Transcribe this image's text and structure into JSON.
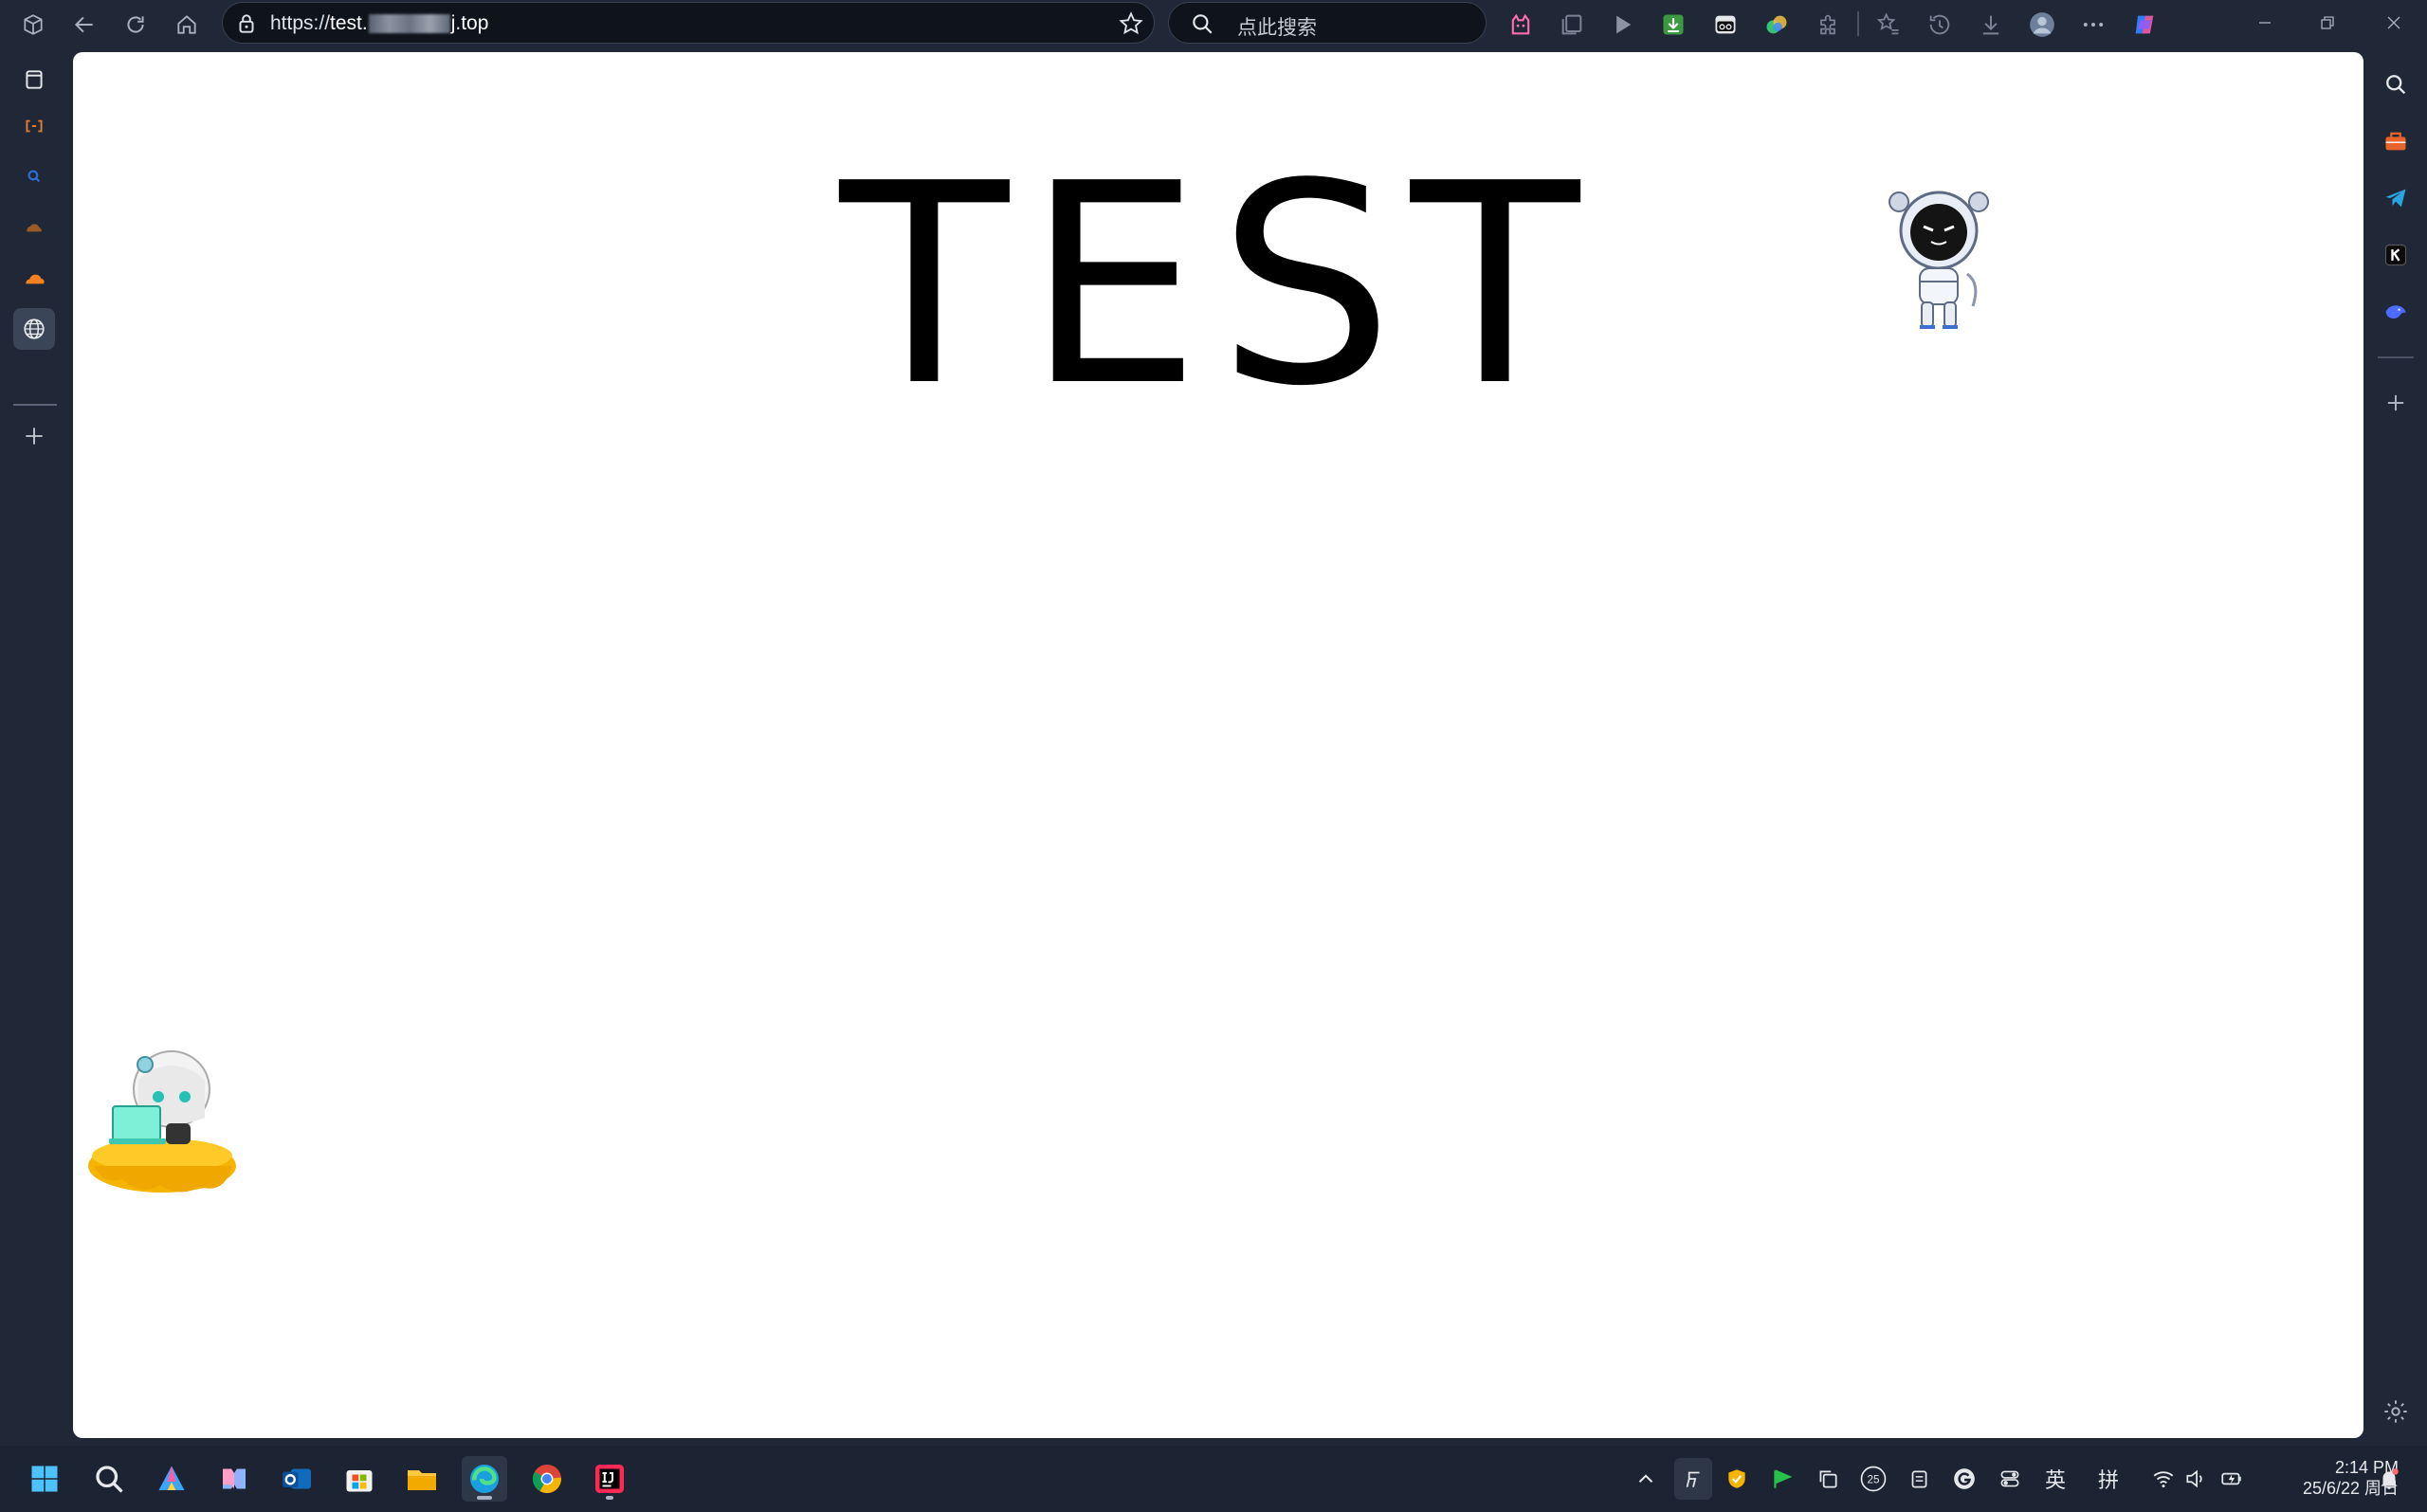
{
  "browser": {
    "address_bar": {
      "url_prefix": "https://",
      "url_host_start": "test.",
      "url_host_end": "j.top"
    },
    "search_box": {
      "placeholder": "点此搜索"
    }
  },
  "page": {
    "heading": "TEST"
  },
  "taskbar": {
    "tray": {
      "ime_lang": "英",
      "ime_mode": "拼",
      "calendar_badge": "25"
    },
    "clock": {
      "time": "2:14 PM",
      "date": "25/6/22 周日"
    }
  },
  "colors": {
    "chrome_bg": "#202736",
    "page_bg": "#ffffff",
    "heading_text": "#000000",
    "taskbar_bg": "#1c2433"
  }
}
